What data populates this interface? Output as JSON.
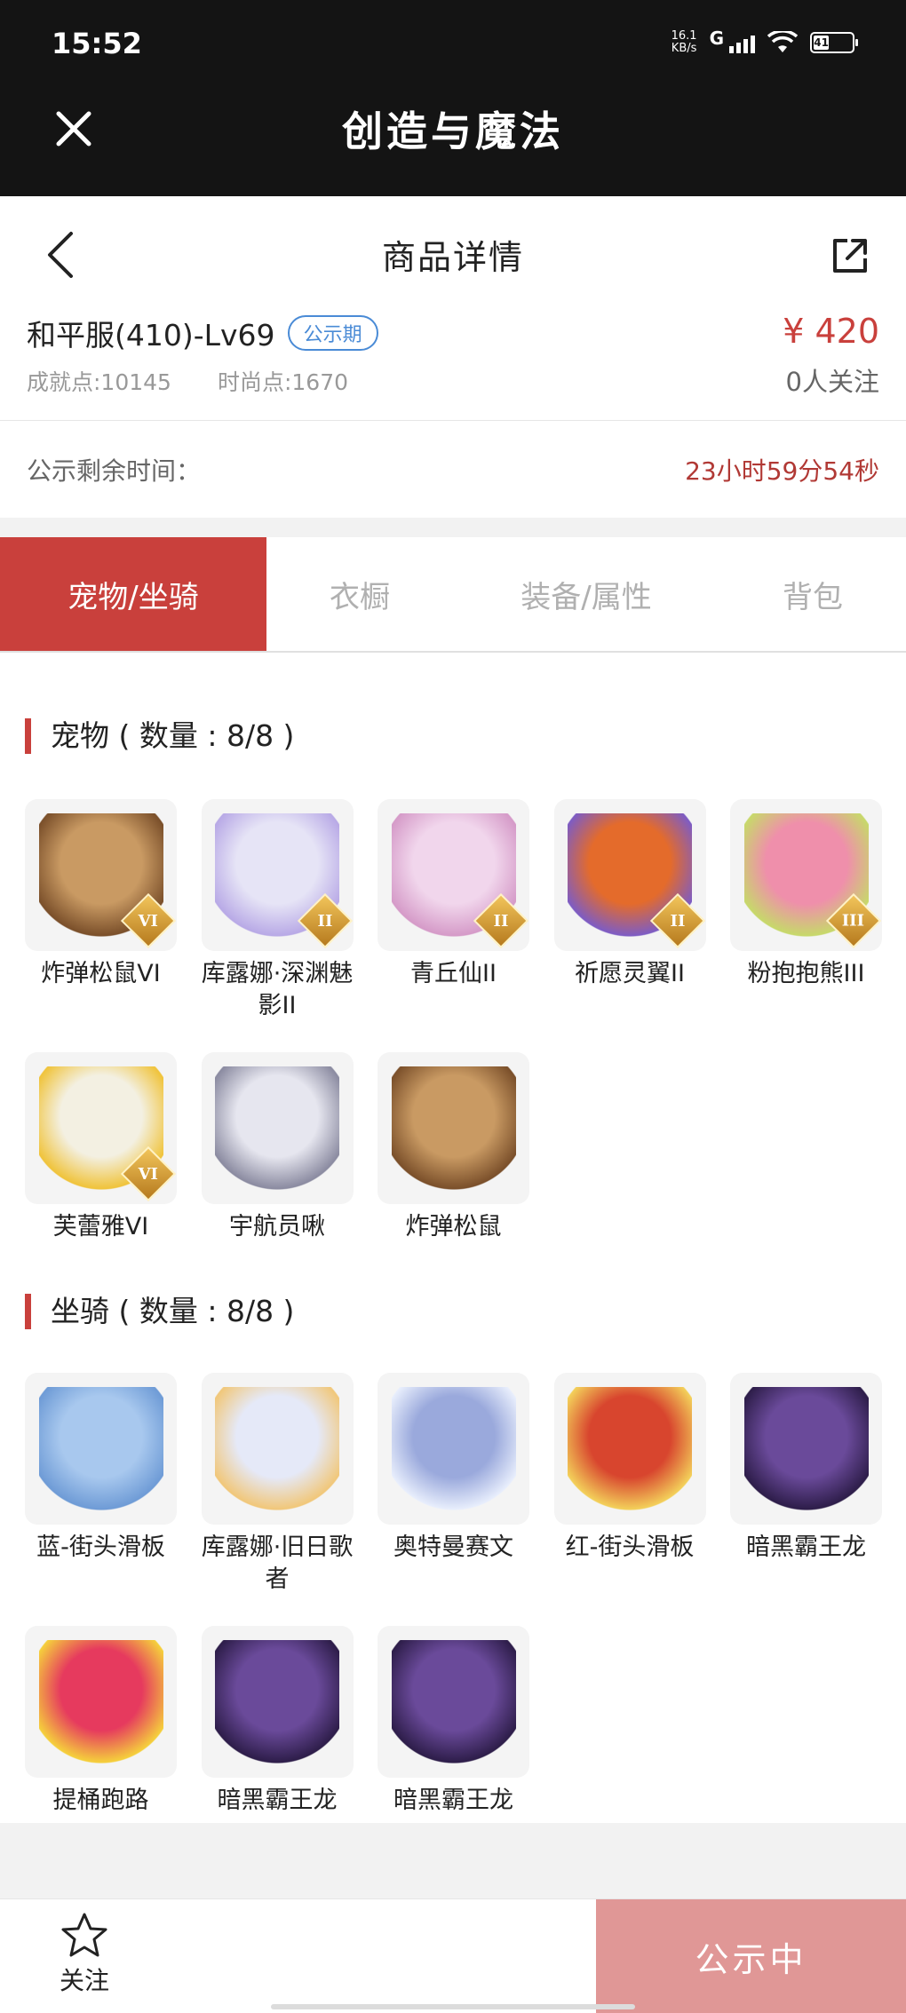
{
  "status_bar": {
    "time": "15:52",
    "net_speed_value": "16.1",
    "net_speed_unit": "KB/s",
    "network": "G",
    "battery": "41"
  },
  "app_bar": {
    "title": "创造与魔法",
    "close_icon": "close-icon"
  },
  "nav": {
    "title": "商品详情",
    "back_icon": "chevron-left-icon",
    "share_icon": "share-icon"
  },
  "item": {
    "name": "和平服(410)-Lv69",
    "badge": "公示期",
    "price": "¥ 420",
    "achievement": "成就点:10145",
    "fashion": "时尚点:1670",
    "followers": "0人关注",
    "countdown_label": "公示剩余时间：",
    "countdown_value": "23小时59分54秒"
  },
  "tabs": [
    "宠物/坐骑",
    "衣橱",
    "装备/属性",
    "背包"
  ],
  "active_tab": 0,
  "pets": {
    "title": "宠物 ( 数量 : 8/8 )",
    "items": [
      {
        "name": "炸弹松鼠VI",
        "rank": "VI"
      },
      {
        "name": "库露娜·深渊魅影II",
        "rank": "II"
      },
      {
        "name": "青丘仙II",
        "rank": "II"
      },
      {
        "name": "祈愿灵翼II",
        "rank": "II"
      },
      {
        "name": "粉抱抱熊III",
        "rank": "III"
      },
      {
        "name": "芙蕾雅VI",
        "rank": "VI"
      },
      {
        "name": "宇航员啾",
        "rank": ""
      },
      {
        "name": "炸弹松鼠",
        "rank": ""
      }
    ]
  },
  "mounts": {
    "title": "坐骑 ( 数量 : 8/8 )",
    "items": [
      {
        "name": "蓝-街头滑板"
      },
      {
        "name": "库露娜·旧日歌者"
      },
      {
        "name": "奥特曼赛文"
      },
      {
        "name": "红-街头滑板"
      },
      {
        "name": "暗黑霸王龙"
      },
      {
        "name": "提桶跑路"
      },
      {
        "name": "暗黑霸王龙"
      },
      {
        "name": "暗黑霸王龙"
      }
    ]
  },
  "bottom_bar": {
    "follow_label": "关注",
    "follow_icon": "star-icon",
    "action_label": "公示中"
  },
  "colors": {
    "accent": "#c9403c",
    "badge_blue": "#4a8bd6",
    "action_disabled": "#e09796"
  }
}
